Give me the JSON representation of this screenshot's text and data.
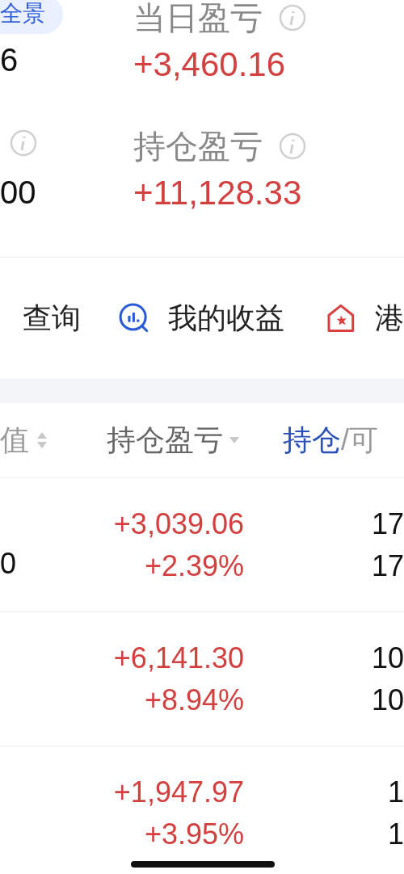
{
  "summary": {
    "badge": "全景",
    "left_values": [
      "6",
      "00"
    ],
    "items": [
      {
        "label": "当日盈亏",
        "value": "+3,460.16"
      },
      {
        "label": "持仓盈亏",
        "value": "+11,128.33"
      }
    ]
  },
  "shortcuts": [
    {
      "label": "查询"
    },
    {
      "label": "我的收益"
    },
    {
      "label": "港"
    }
  ],
  "table": {
    "columns": [
      {
        "label": "值"
      },
      {
        "label": "持仓盈亏"
      }
    ],
    "toggle": [
      {
        "label": "持仓",
        "selected": true
      },
      {
        "label": "/可",
        "selected": false
      }
    ],
    "rows": [
      {
        "column_1": "0",
        "pnl": "+3,039.06",
        "pnl_pct": "+2.39%",
        "column_4": [
          "17",
          "17"
        ]
      },
      {
        "pnl": "+6,141.30",
        "pnl_pct": "+8.94%",
        "column_4": [
          "10",
          "10"
        ]
      },
      {
        "pnl": "+1,947.97",
        "pnl_pct": "+3.95%",
        "column_4": [
          "1",
          "1"
        ]
      }
    ]
  }
}
